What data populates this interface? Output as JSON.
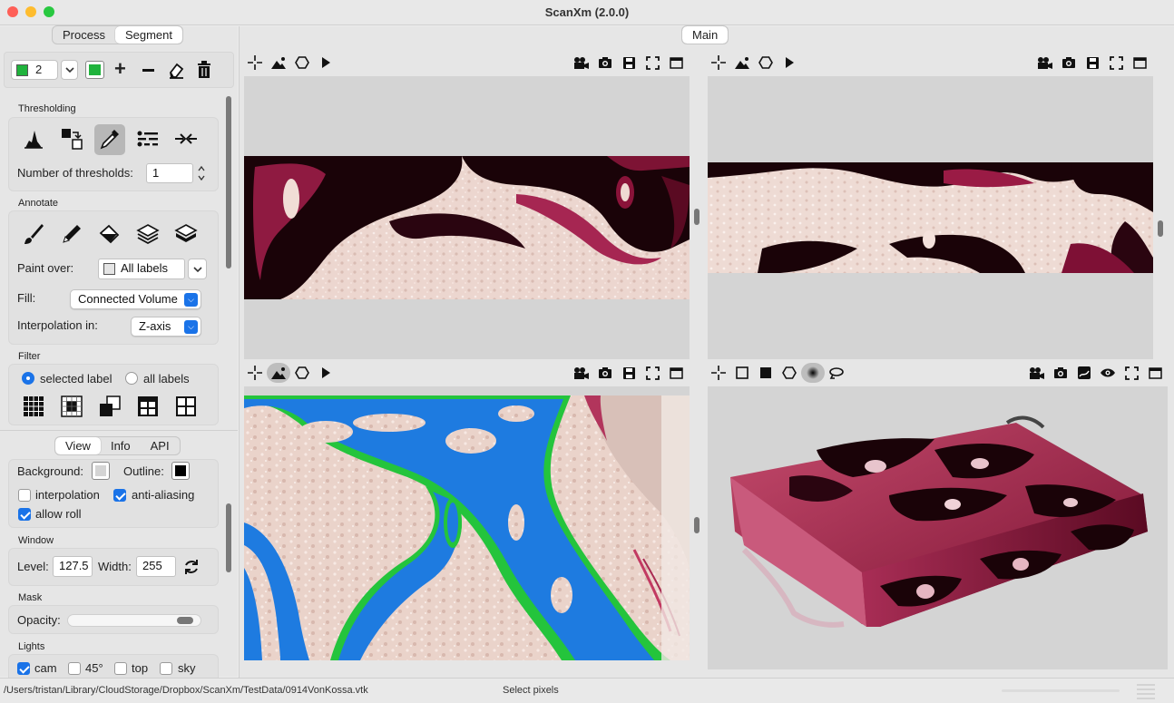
{
  "window": {
    "title": "ScanXm (2.0.0)"
  },
  "left_tabs": {
    "process": "Process",
    "segment": "Segment"
  },
  "label_bar": {
    "label_number": "2",
    "label_color": "#1fb33c"
  },
  "thresholding": {
    "section": "Thresholding",
    "num_thresholds_label": "Number of thresholds:",
    "num_thresholds_value": "1"
  },
  "annotate": {
    "section": "Annotate",
    "paint_over_label": "Paint over:",
    "paint_over_value": "All labels",
    "fill_label": "Fill:",
    "fill_value": "Connected Volume",
    "interp_label": "Interpolation in:",
    "interp_value": "Z-axis"
  },
  "filter": {
    "section": "Filter",
    "selected_label": "selected label",
    "all_labels": "all labels"
  },
  "bottom_tabs": {
    "view": "View",
    "info": "Info",
    "api": "API"
  },
  "view_settings": {
    "background_label": "Background:",
    "outline_label": "Outline:",
    "interpolation": "interpolation",
    "anti_aliasing": "anti-aliasing",
    "allow_roll": "allow roll"
  },
  "window_settings": {
    "section": "Window",
    "level_label": "Level:",
    "level_value": "127.5",
    "width_label": "Width:",
    "width_value": "255"
  },
  "mask": {
    "section": "Mask",
    "opacity_label": "Opacity:",
    "opacity_value": 0.95
  },
  "lights": {
    "section": "Lights",
    "cam": "cam",
    "deg45": "45°",
    "top": "top",
    "sky": "sky"
  },
  "main_tab": "Main",
  "status": {
    "path": "/Users/tristan/Library/CloudStorage/Dropbox/ScanXm/TestData/0914VonKossa.vtk",
    "message": "Select pixels"
  },
  "colors": {
    "accent": "#1a73e8",
    "label_green": "#1fb33c",
    "tissue_pink": "#c1305a",
    "mask_blue": "#1e7be0"
  }
}
